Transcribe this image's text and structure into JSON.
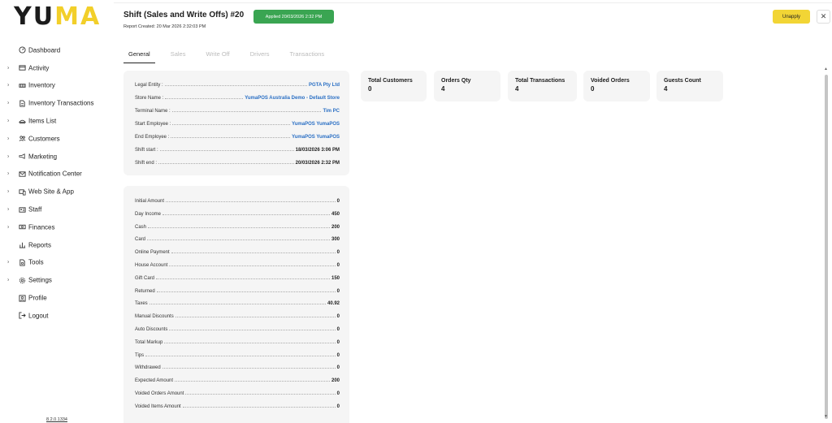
{
  "brand": {
    "part1": "YU",
    "part2": "MA",
    "accent_color": "#f2cf2a"
  },
  "sidebar": {
    "items": [
      {
        "label": "Dashboard",
        "icon": "dashboard-icon",
        "expandable": false
      },
      {
        "label": "Activity",
        "icon": "activity-icon",
        "expandable": true
      },
      {
        "label": "Inventory",
        "icon": "inventory-icon",
        "expandable": true
      },
      {
        "label": "Inventory Transactions",
        "icon": "document-icon",
        "expandable": true
      },
      {
        "label": "Items List",
        "icon": "items-icon",
        "expandable": true
      },
      {
        "label": "Customers",
        "icon": "customers-icon",
        "expandable": true
      },
      {
        "label": "Marketing",
        "icon": "marketing-icon",
        "expandable": true
      },
      {
        "label": "Notification Center",
        "icon": "mail-icon",
        "expandable": true
      },
      {
        "label": "Web Site & App",
        "icon": "devices-icon",
        "expandable": true
      },
      {
        "label": "Staff",
        "icon": "staff-icon",
        "expandable": true
      },
      {
        "label": "Finances",
        "icon": "finances-icon",
        "expandable": true
      },
      {
        "label": "Reports",
        "icon": "reports-icon",
        "expandable": false
      },
      {
        "label": "Tools",
        "icon": "tools-icon",
        "expandable": true
      },
      {
        "label": "Settings",
        "icon": "gear-icon",
        "expandable": true
      },
      {
        "label": "Profile",
        "icon": "profile-icon",
        "expandable": false
      },
      {
        "label": "Logout",
        "icon": "logout-icon",
        "expandable": false
      }
    ],
    "version": "8.2.0.1334"
  },
  "header": {
    "title": "Shift (Sales and Write Offs) #20",
    "badge": "Applied 20/03/2026 2:32 PM",
    "badge_color": "#3aa552",
    "subtitle": "Report Created: 20 Mar 2026 2:32:03 PM",
    "unapply_label": "Unapply",
    "close_icon": "close-icon"
  },
  "tabs": [
    {
      "label": "General",
      "active": true
    },
    {
      "label": "Sales",
      "active": false
    },
    {
      "label": "Write Off",
      "active": false
    },
    {
      "label": "Drivers",
      "active": false
    },
    {
      "label": "Transactions",
      "active": false
    }
  ],
  "info": [
    {
      "label": "Legal Entity :",
      "value": "PGTA Pty Ltd",
      "link": true
    },
    {
      "label": "Store Name :",
      "value": "YumaPOS Australia Demo - Default Store",
      "link": true
    },
    {
      "label": "Terminal Name :",
      "value": "Tim PC",
      "link": true
    },
    {
      "label": "Start Employee :",
      "value": "YumaPOS YumaPOS",
      "link": true
    },
    {
      "label": "End Employee :",
      "value": "YumaPOS YumaPOS",
      "link": true
    },
    {
      "label": "Shift start :",
      "value": "18/03/2026 3:06 PM",
      "link": false
    },
    {
      "label": "Shift end :",
      "value": "20/03/2026 2:32 PM",
      "link": false
    }
  ],
  "totals": [
    {
      "label": "Initial Amount",
      "value": "0"
    },
    {
      "label": "Day Income",
      "value": "450"
    },
    {
      "label": "Cash",
      "value": "200"
    },
    {
      "label": "Card",
      "value": "300"
    },
    {
      "label": "Online Payment",
      "value": "0"
    },
    {
      "label": "House Account",
      "value": "0"
    },
    {
      "label": "Gift Card",
      "value": "150"
    },
    {
      "label": "Returned",
      "value": "0"
    },
    {
      "label": "Taxes",
      "value": "40.92"
    },
    {
      "label": "Manual Discounts",
      "value": "0"
    },
    {
      "label": "Auto Discounts",
      "value": "0"
    },
    {
      "label": "Total Markup",
      "value": "0"
    },
    {
      "label": "Tips",
      "value": "0"
    },
    {
      "label": "Withdrawed",
      "value": "0"
    },
    {
      "label": "Expected Amount",
      "value": "200"
    },
    {
      "label": "Voided Orders Amount",
      "value": "0"
    },
    {
      "label": "Voided Items Amount",
      "value": "0"
    }
  ],
  "stats": [
    {
      "label": "Total Customers",
      "value": "0"
    },
    {
      "label": "Orders Qty",
      "value": "4"
    },
    {
      "label": "Total Transactions",
      "value": "4"
    },
    {
      "label": "Voided Orders",
      "value": "0"
    },
    {
      "label": "Guests Count",
      "value": "4"
    }
  ]
}
